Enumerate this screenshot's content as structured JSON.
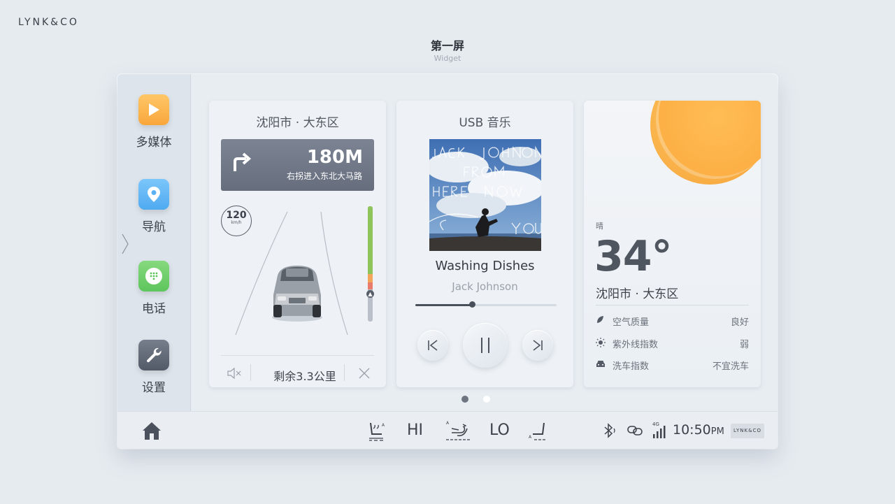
{
  "brand": "LYNK&CO",
  "header": {
    "title": "第一屏",
    "subtitle": "Widget"
  },
  "sidebar": {
    "items": [
      {
        "label": "多媒体",
        "icon": "play-icon",
        "color": "#f9a63a"
      },
      {
        "label": "导航",
        "icon": "location-pin-icon",
        "color": "#4faaf0"
      },
      {
        "label": "电话",
        "icon": "phone-dialpad-icon",
        "color": "#5ec55c"
      },
      {
        "label": "设置",
        "icon": "wrench-icon",
        "color": "#5d6472"
      }
    ]
  },
  "navigation": {
    "location": "沈阳市 · 大东区",
    "distance": "180M",
    "instruction": "右拐进入东北大马路",
    "speed_limit": "120",
    "speed_unit": "km/h",
    "remaining": "剩余3.3公里"
  },
  "music": {
    "source": "USB 音乐",
    "song": "Washing Dishes",
    "artist": "Jack Johnson",
    "progress": 0.4
  },
  "weather": {
    "condition": "晴",
    "temperature": "34°",
    "location": "沈阳市 · 大东区",
    "rows": [
      {
        "label": "空气质量",
        "value": "良好",
        "icon": "leaf-icon"
      },
      {
        "label": "紫外线指数",
        "value": "弱",
        "icon": "sun-small-icon"
      },
      {
        "label": "洗车指数",
        "value": "不宜洗车",
        "icon": "car-small-icon"
      }
    ]
  },
  "pagination": {
    "count": 2,
    "active": 0
  },
  "bottombar": {
    "fan_left": "HI",
    "fan_right": "LO",
    "network": "4G",
    "time": "10:50",
    "ampm": "PM",
    "badge": "LYNK&CO"
  },
  "colors": {
    "accent_orange": "#f9a63a",
    "traffic_green": "#8fc45a",
    "traffic_orange": "#f3a65a",
    "traffic_red": "#ea7c6c"
  }
}
